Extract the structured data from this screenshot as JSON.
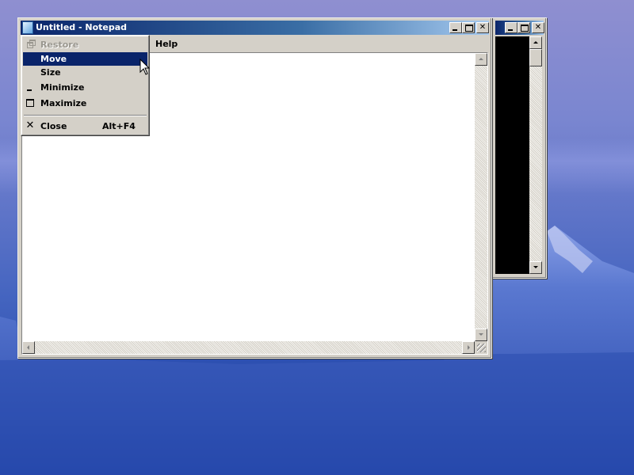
{
  "notepad": {
    "title": "Untitled - Notepad",
    "menu": {
      "help": "Help"
    }
  },
  "console": {
    "title": ""
  },
  "system_menu": {
    "items": [
      {
        "label": "Restore",
        "icon": "restore-icon",
        "state": "disabled"
      },
      {
        "label": "Move",
        "icon": "",
        "state": "selected"
      },
      {
        "label": "Size",
        "icon": "",
        "state": "normal"
      },
      {
        "label": "Minimize",
        "icon": "minimize-icon",
        "state": "normal"
      },
      {
        "label": "Maximize",
        "icon": "maximize-icon",
        "state": "normal"
      },
      {
        "label": "Close",
        "icon": "close-icon",
        "state": "normal",
        "shortcut": "Alt+F4"
      }
    ]
  },
  "colors": {
    "selection": "#0a246a",
    "face": "#d4d0c8",
    "console_bg": "#000000"
  }
}
